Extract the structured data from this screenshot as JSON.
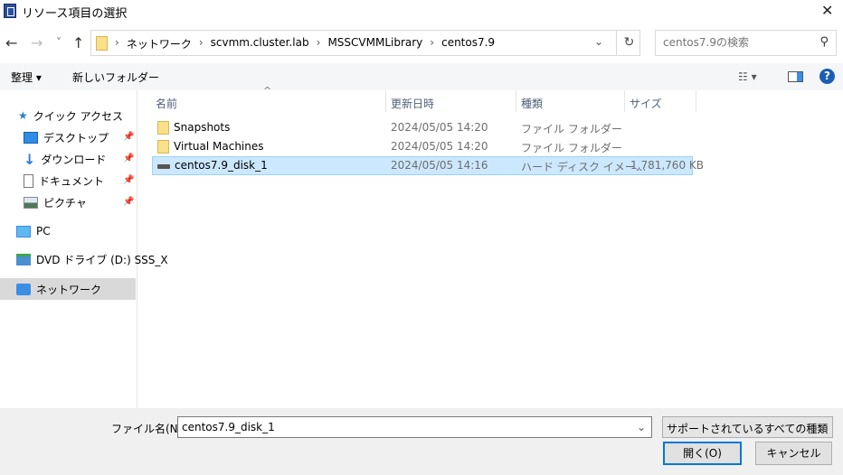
{
  "window": {
    "title": "リソース項目の選択",
    "close": "✕"
  },
  "nav": {
    "back": "←",
    "forward": "→",
    "recent": "˅",
    "up": "↑"
  },
  "address": {
    "crumbs": [
      "ネットワーク",
      "scvmm.cluster.lab",
      "MSSCVMMLibrary",
      "centos7.9"
    ],
    "sep": "›",
    "dropdown": "⌄",
    "refresh": "↻"
  },
  "search": {
    "placeholder": "centos7.9の検索",
    "icon": "⚲"
  },
  "toolbar": {
    "organize": "整理 ▾",
    "new_folder": "新しいフォルダー",
    "view": "☷ ▾",
    "help": "?"
  },
  "sidebar": {
    "items": [
      {
        "label": "クイック アクセス",
        "icon": "star-icon"
      },
      {
        "label": "デスクトップ",
        "icon": "desktop-icon",
        "pinned": true
      },
      {
        "label": "ダウンロード",
        "icon": "download-icon",
        "pinned": true
      },
      {
        "label": "ドキュメント",
        "icon": "document-icon",
        "pinned": true
      },
      {
        "label": "ピクチャ",
        "icon": "picture-icon",
        "pinned": true
      },
      {
        "label": "PC",
        "icon": "pc-icon"
      },
      {
        "label": "DVD ドライブ (D:) SSS_X",
        "icon": "dvd-icon"
      },
      {
        "label": "ネットワーク",
        "icon": "network-icon",
        "selected": true
      }
    ],
    "pin": "📌"
  },
  "columns": {
    "name": "名前",
    "date": "更新日時",
    "type": "種類",
    "size": "サイズ",
    "sort": "^"
  },
  "files": [
    {
      "name": "Snapshots",
      "date": "2024/05/05 14:20",
      "type": "ファイル フォルダー",
      "size": ""
    },
    {
      "name": "Virtual Machines",
      "date": "2024/05/05 14:20",
      "type": "ファイル フォルダー",
      "size": ""
    },
    {
      "name": "centos7.9_disk_1",
      "date": "2024/05/05 14:16",
      "type": "ハード ディスク イメー...",
      "size": "1,781,760 KB"
    }
  ],
  "footer": {
    "filename_label": "ファイル名(N):",
    "filename": "centos7.9_disk_1",
    "filter": "サポートされているすべての種類",
    "open": "開く(O)",
    "cancel": "キャンセル",
    "dd": "⌄"
  }
}
